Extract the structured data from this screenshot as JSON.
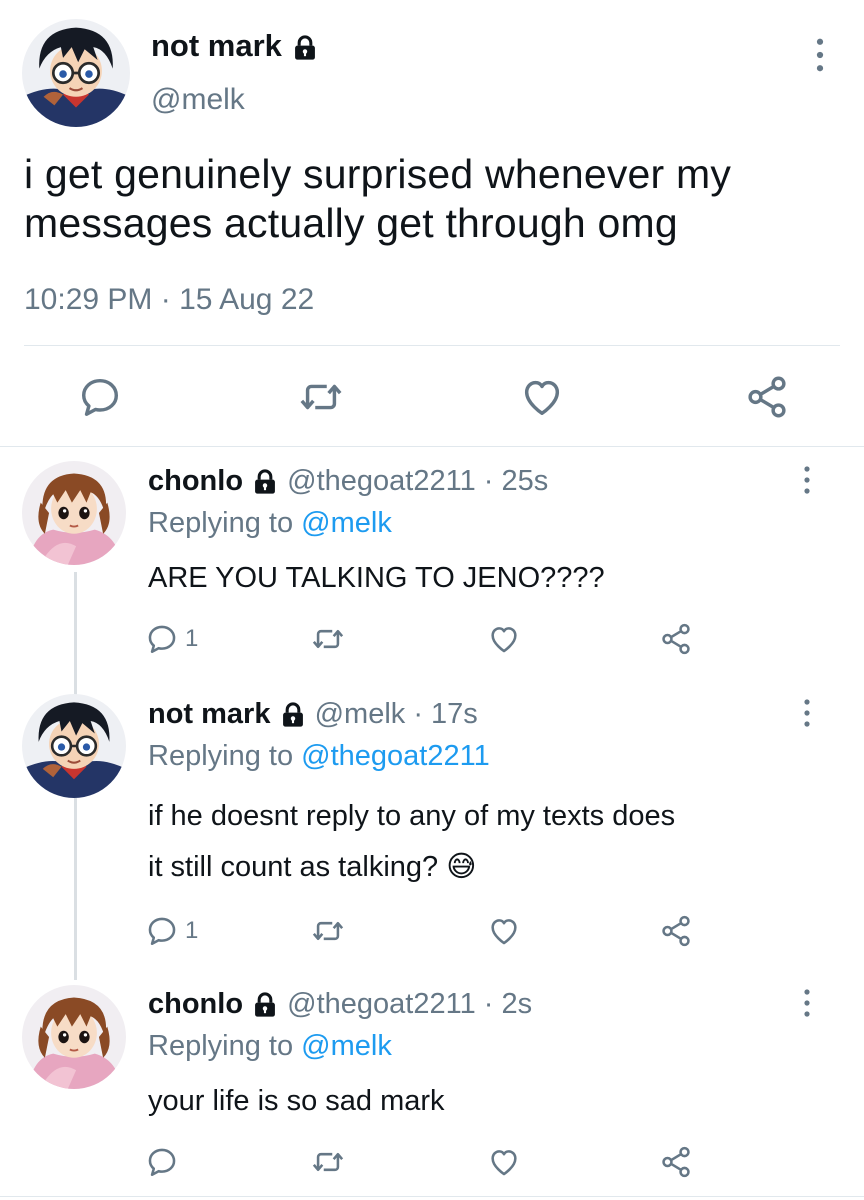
{
  "colors": {
    "accent": "#1d9bf0",
    "text": "#0f1419",
    "secondary": "#657786",
    "divider": "#e1e8ed"
  },
  "main_tweet": {
    "display_name": "not mark",
    "handle": "@melk",
    "text_line1": "i get genuinely surprised whenever my",
    "text_line2": "messages actually get through omg",
    "timestamp": "10:29 PM · 15 Aug 22",
    "icons": [
      "reply-icon",
      "retweet-icon",
      "like-icon",
      "share-icon"
    ]
  },
  "replies": [
    {
      "display_name": "chonlo",
      "handle_time": "@thegoat2211 · 25s",
      "replying_prefix": "Replying to",
      "replying_to": "@melk",
      "text": "ARE YOU TALKING TO JENO????",
      "reply_count": "1"
    },
    {
      "display_name": "not mark",
      "handle_time": "@melk · 17s",
      "replying_prefix": "Replying to",
      "replying_to": "@thegoat2211",
      "text_line1": "if he doesnt reply to any of my texts does",
      "text_line2": "it still count as talking?",
      "emoji": "😅",
      "reply_count": "1"
    },
    {
      "display_name": "chonlo",
      "handle_time": "@thegoat2211 · 2s",
      "replying_prefix": "Replying to",
      "replying_to": "@melk",
      "text": "your life is so sad mark",
      "reply_count": ""
    }
  ]
}
